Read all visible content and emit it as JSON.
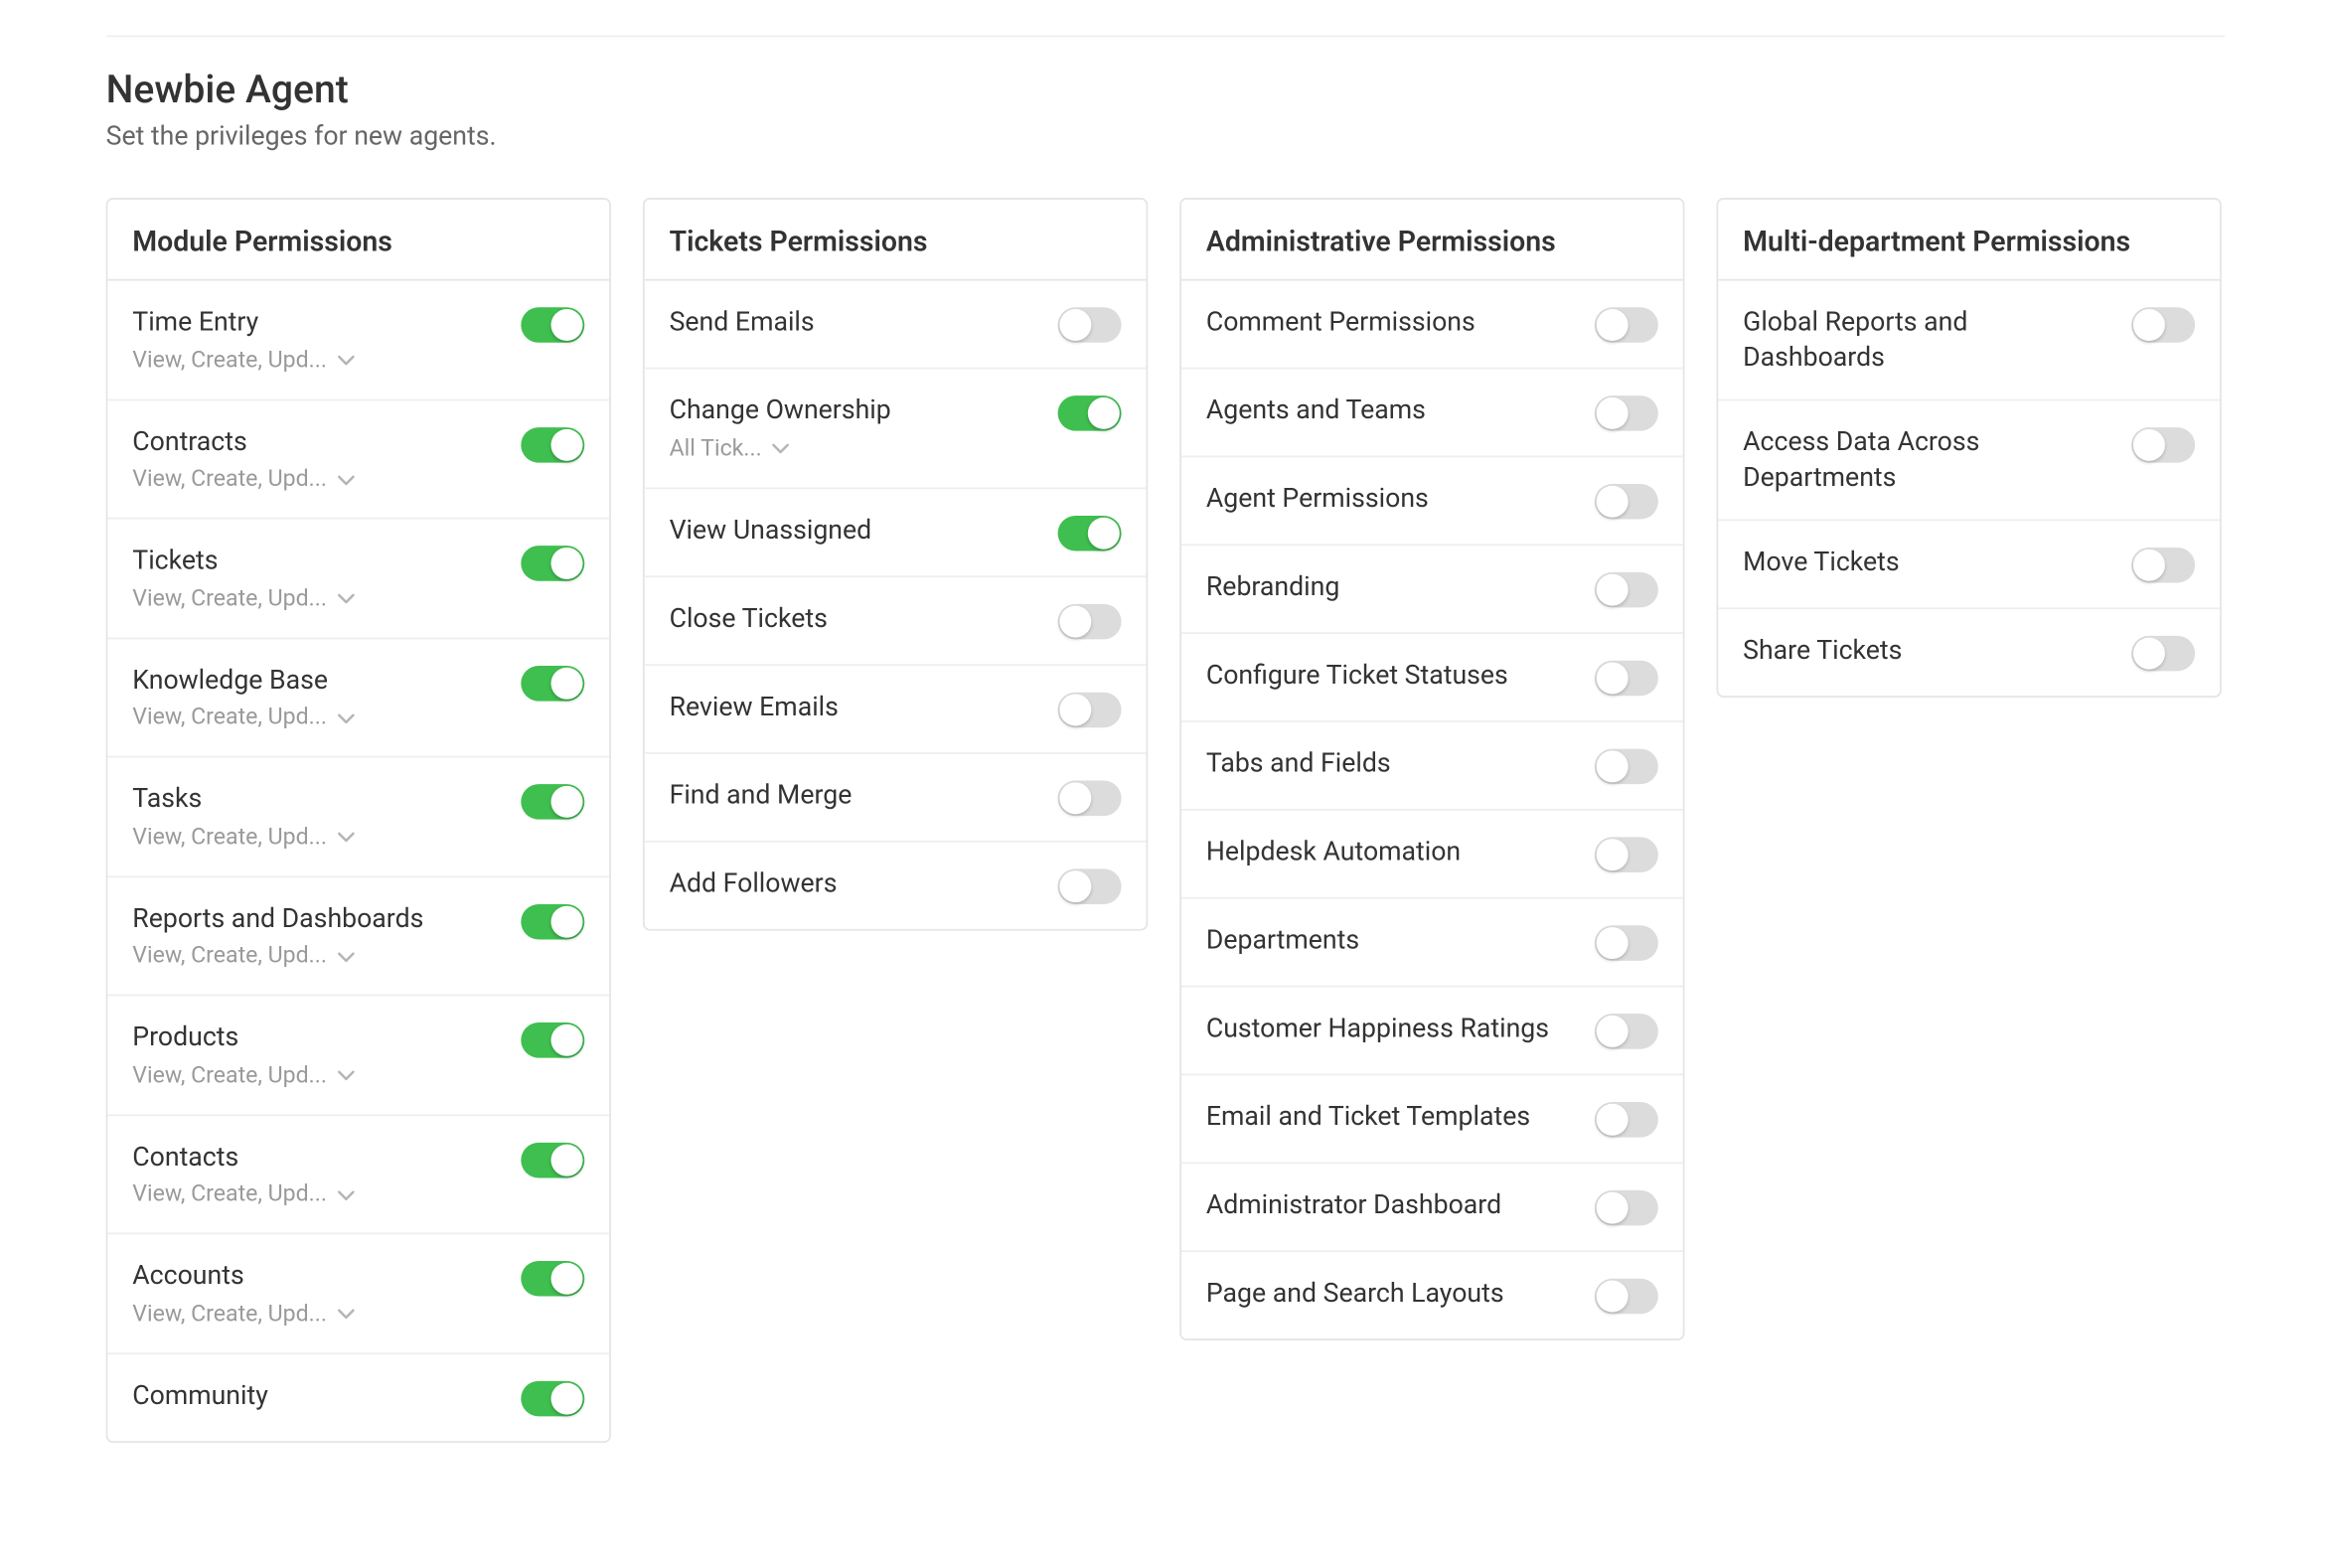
{
  "header": {
    "title": "Newbie Agent",
    "subtitle": "Set the privileges for new agents."
  },
  "columns": [
    {
      "id": "module",
      "title": "Module Permissions",
      "items": [
        {
          "id": "time-entry",
          "label": "Time Entry",
          "sub": "View, Create, Upd...",
          "hasSub": true,
          "on": true
        },
        {
          "id": "contracts",
          "label": "Contracts",
          "sub": "View, Create, Upd...",
          "hasSub": true,
          "on": true
        },
        {
          "id": "tickets",
          "label": "Tickets",
          "sub": "View, Create, Upd...",
          "hasSub": true,
          "on": true
        },
        {
          "id": "knowledge-base",
          "label": "Knowledge Base",
          "sub": "View, Create, Upd...",
          "hasSub": true,
          "on": true
        },
        {
          "id": "tasks",
          "label": "Tasks",
          "sub": "View, Create, Upd...",
          "hasSub": true,
          "on": true
        },
        {
          "id": "reports-dashboards",
          "label": "Reports and Dashboards",
          "sub": "View, Create, Upd...",
          "hasSub": true,
          "on": true
        },
        {
          "id": "products",
          "label": "Products",
          "sub": "View, Create, Upd...",
          "hasSub": true,
          "on": true
        },
        {
          "id": "contacts",
          "label": "Contacts",
          "sub": "View, Create, Upd...",
          "hasSub": true,
          "on": true
        },
        {
          "id": "accounts",
          "label": "Accounts",
          "sub": "View, Create, Upd...",
          "hasSub": true,
          "on": true
        },
        {
          "id": "community",
          "label": "Community",
          "sub": "",
          "hasSub": false,
          "on": true
        }
      ]
    },
    {
      "id": "tickets",
      "title": "Tickets Permissions",
      "items": [
        {
          "id": "send-emails",
          "label": "Send Emails",
          "hasSub": false,
          "on": false
        },
        {
          "id": "change-ownership",
          "label": "Change Ownership",
          "sub": "All Tick...",
          "hasSub": true,
          "on": true
        },
        {
          "id": "view-unassigned",
          "label": "View Unassigned",
          "hasSub": false,
          "on": true
        },
        {
          "id": "close-tickets",
          "label": "Close Tickets",
          "hasSub": false,
          "on": false
        },
        {
          "id": "review-emails",
          "label": "Review Emails",
          "hasSub": false,
          "on": false
        },
        {
          "id": "find-merge",
          "label": "Find and Merge",
          "hasSub": false,
          "on": false
        },
        {
          "id": "add-followers",
          "label": "Add Followers",
          "hasSub": false,
          "on": false
        }
      ]
    },
    {
      "id": "admin",
      "title": "Administrative Permissions",
      "items": [
        {
          "id": "comment-permissions",
          "label": "Comment Permissions",
          "hasSub": false,
          "on": false
        },
        {
          "id": "agents-teams",
          "label": "Agents and Teams",
          "hasSub": false,
          "on": false
        },
        {
          "id": "agent-permissions",
          "label": "Agent Permissions",
          "hasSub": false,
          "on": false
        },
        {
          "id": "rebranding",
          "label": "Rebranding",
          "hasSub": false,
          "on": false
        },
        {
          "id": "configure-ticket-status",
          "label": "Configure Ticket Statuses",
          "hasSub": false,
          "on": false
        },
        {
          "id": "tabs-fields",
          "label": "Tabs and Fields",
          "hasSub": false,
          "on": false
        },
        {
          "id": "helpdesk-automation",
          "label": "Helpdesk Automation",
          "hasSub": false,
          "on": false
        },
        {
          "id": "departments",
          "label": "Departments",
          "hasSub": false,
          "on": false
        },
        {
          "id": "customer-happiness",
          "label": "Customer Happiness Ratings",
          "hasSub": false,
          "on": false
        },
        {
          "id": "email-ticket-templates",
          "label": "Email and Ticket Templates",
          "hasSub": false,
          "on": false
        },
        {
          "id": "admin-dashboard",
          "label": "Administrator Dashboard",
          "hasSub": false,
          "on": false
        },
        {
          "id": "page-search-layouts",
          "label": "Page and Search Layouts",
          "hasSub": false,
          "on": false
        }
      ]
    },
    {
      "id": "multidept",
      "title": "Multi-department Permissions",
      "items": [
        {
          "id": "global-reports-dashboards",
          "label": "Global Reports and Dashboards",
          "hasSub": false,
          "on": false
        },
        {
          "id": "access-data-across-depts",
          "label": "Access Data Across Departments",
          "hasSub": false,
          "on": false
        },
        {
          "id": "move-tickets",
          "label": "Move Tickets",
          "hasSub": false,
          "on": false
        },
        {
          "id": "share-tickets",
          "label": "Share Tickets",
          "hasSub": false,
          "on": false
        }
      ]
    }
  ]
}
